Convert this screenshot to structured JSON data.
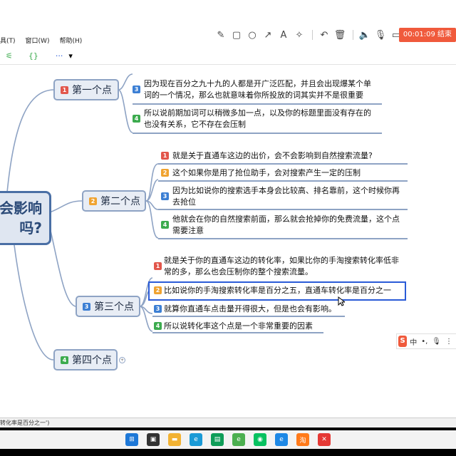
{
  "recorder": {
    "tools": [
      "pen-icon",
      "rect-icon",
      "circle-icon",
      "arrow-icon",
      "text-icon",
      "magic-icon",
      "undo-icon",
      "trash-icon",
      "speaker-icon",
      "mic-icon",
      "camera-icon"
    ],
    "timer_label": "00:01:09 结束"
  },
  "menu": {
    "tools": "具(T)",
    "window": "窗口(W)",
    "help": "帮助(H)"
  },
  "toolbar": {
    "more": "···",
    "dropdown": "▾"
  },
  "mindmap": {
    "root_line1": "会影响",
    "root_line2": "吗?",
    "branches": [
      {
        "num": "1",
        "label": "第一个点",
        "leaves": [
          {
            "num": "3",
            "text": "因为现在百分之九十九的人都是开广泛匹配，并且会出现爆某个单词的一个情况，那么也就意味着你所投放的词其实并不是很重要"
          },
          {
            "num": "4",
            "text": "所以说前期加词可以稍微多加一点，以及你的标题里面没有存在的也没有关系，它不存在会压制"
          }
        ]
      },
      {
        "num": "2",
        "label": "第二个点",
        "leaves": [
          {
            "num": "1",
            "text": "就是关于直通车这边的出价，会不会影响到自然搜索流量?"
          },
          {
            "num": "2",
            "text": "这个如果你是用了抢位助手，会对搜索产生一定的压制"
          },
          {
            "num": "3",
            "text": "因为比如说你的搜索选手本身会比较高、排名靠前，这个时候你再去抢位"
          },
          {
            "num": "4",
            "text": "他就会在你的自然搜索前面，那么就会抢掉你的免费流量，这个点需要注意"
          }
        ]
      },
      {
        "num": "3",
        "label": "第三个点",
        "leaves": [
          {
            "num": "1",
            "text": "就是关于你的直通车这边的转化率，如果比你的手淘搜索转化率低非常的多，那么也会压制你的整个搜索流量。"
          },
          {
            "num": "2",
            "text": "比如说你的手淘搜索转化率是百分之五，直通车转化率是百分之一"
          },
          {
            "num": "3",
            "text": "就算你直通车点击量开得很大，但是也会有影响。"
          },
          {
            "num": "4",
            "text": "所以说转化率这个点是一个非常重要的因素"
          }
        ]
      },
      {
        "num": "4",
        "label": "第四个点",
        "leaves": []
      }
    ]
  },
  "status": {
    "text": "转化率是百分之一')"
  },
  "ime": {
    "logo": "S",
    "lang": "中",
    "punct": "•,",
    "mic": "🎙",
    "more": "⋮"
  },
  "colors": {
    "recorder_stop": "#f05a3c",
    "branch_border": "#8ea3c4",
    "root_border": "#4a6fa5",
    "selection": "#2a5bd7"
  }
}
